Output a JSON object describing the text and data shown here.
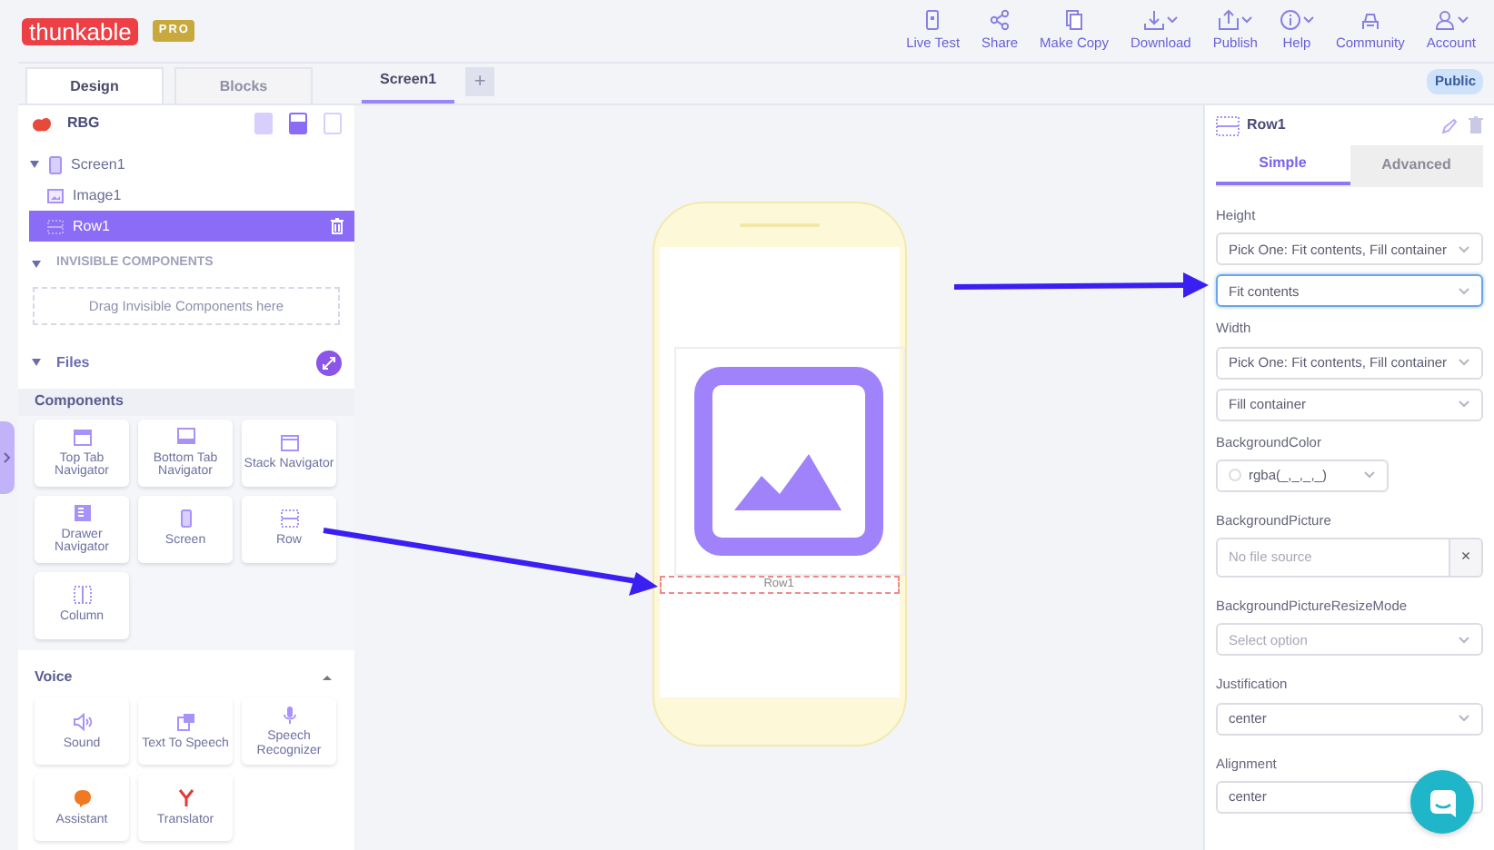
{
  "logo": {
    "text": "thunkable",
    "badge": "PRO"
  },
  "toolbar": [
    {
      "label": "Live Test",
      "caret": false
    },
    {
      "label": "Share",
      "caret": false
    },
    {
      "label": "Make Copy",
      "caret": false
    },
    {
      "label": "Download",
      "caret": true
    },
    {
      "label": "Publish",
      "caret": true
    },
    {
      "label": "Help",
      "caret": true
    },
    {
      "label": "Community",
      "caret": false
    },
    {
      "label": "Account",
      "caret": true
    }
  ],
  "editor_tabs": [
    {
      "label": "Design",
      "selected": true
    },
    {
      "label": "Blocks",
      "selected": false
    }
  ],
  "screen_tabs": [
    {
      "label": "Screen1",
      "selected": true
    }
  ],
  "add_screen": "+",
  "visibility": "Public",
  "project": {
    "name": "RBG",
    "devices": [
      {
        "selected": false
      },
      {
        "selected": true
      },
      {
        "selected": false
      }
    ]
  },
  "tree": [
    {
      "label": "Screen1",
      "expanded": true,
      "selected": false,
      "children": [
        {
          "label": "Image1",
          "selected": false
        },
        {
          "label": "Row1",
          "selected": true
        }
      ]
    }
  ],
  "invisible": {
    "title": "INVISIBLE COMPONENTS",
    "dropzone": "Drag Invisible Components here"
  },
  "files": {
    "title": "Files"
  },
  "components_title": "Components",
  "component_groups": [
    {
      "items": [
        "Top Tab Navigator",
        "Bottom Tab Navigator",
        "Stack Navigator",
        "Drawer Navigator",
        "Screen",
        "Row",
        "Column"
      ]
    },
    {
      "title": "Voice",
      "expanded": true,
      "items": [
        "Sound",
        "Text To Speech",
        "Speech Recognizer",
        "Assistant",
        "Translator"
      ]
    }
  ],
  "canvas": {
    "row_label": "Row1"
  },
  "inspector": {
    "title": "Row1",
    "tabs": [
      {
        "label": "Simple",
        "selected": true
      },
      {
        "label": "Advanced",
        "selected": false
      }
    ],
    "properties": [
      {
        "label": "Height",
        "fields": [
          {
            "kind": "select",
            "value": "Pick One: Fit contents, Fill container",
            "focused": false
          },
          {
            "kind": "select",
            "value": "Fit contents",
            "focused": true
          }
        ]
      },
      {
        "label": "Width",
        "fields": [
          {
            "kind": "select",
            "value": "Pick One: Fit contents, Fill container",
            "focused": false
          },
          {
            "kind": "select",
            "value": "Fill container",
            "focused": false
          }
        ]
      },
      {
        "label": "BackgroundColor",
        "fields": [
          {
            "kind": "color",
            "value": "rgba(_,_,_,_)",
            "focused": false
          }
        ]
      },
      {
        "label": "BackgroundPicture",
        "fields": [
          {
            "kind": "file",
            "placeholder": "No file source",
            "clear": "×",
            "focused": false
          }
        ]
      },
      {
        "label": "BackgroundPictureResizeMode",
        "fields": [
          {
            "kind": "select",
            "placeholder": "Select option",
            "focused": false
          }
        ]
      },
      {
        "label": "Justification",
        "fields": [
          {
            "kind": "select",
            "value": "center",
            "focused": false
          }
        ]
      },
      {
        "label": "Alignment",
        "fields": [
          {
            "kind": "select",
            "value": "center",
            "focused": false
          }
        ]
      }
    ]
  }
}
